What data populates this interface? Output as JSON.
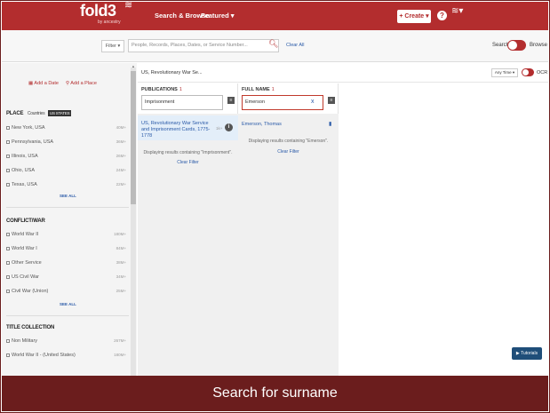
{
  "nav": {
    "logo_text": "fold3",
    "logo_sub": "by ancestry",
    "search_browse": "Search & Browse",
    "featured": "Featured ▾",
    "create": "+ Create ▾",
    "help": "?"
  },
  "search": {
    "filter": "Filter ▾",
    "placeholder": "People, Records, Places, Dates, or Service Number...",
    "clear_all": "Clear All",
    "mode_search": "Search",
    "mode_browse": "Browse"
  },
  "left": {
    "add_date": "Add a Date",
    "add_place": "Add a Place",
    "place": {
      "title": "PLACE",
      "sub": "Countries",
      "tag": "US States",
      "items": [
        {
          "label": "New York, USA",
          "count": "40M+"
        },
        {
          "label": "Pennsylvania, USA",
          "count": "36M+"
        },
        {
          "label": "Illinois, USA",
          "count": "26M+"
        },
        {
          "label": "Ohio, USA",
          "count": "24M+"
        },
        {
          "label": "Texas, USA",
          "count": "22M+"
        }
      ],
      "see_all": "SEE ALL"
    },
    "conflict": {
      "title": "CONFLICT/WAR",
      "items": [
        {
          "label": "World War II",
          "count": "180M+"
        },
        {
          "label": "World War I",
          "count": "84M+"
        },
        {
          "label": "Other Service",
          "count": "38M+"
        },
        {
          "label": "US Civil War",
          "count": "34M+"
        },
        {
          "label": "Civil War (Union)",
          "count": "25M+"
        }
      ],
      "see_all": "SEE ALL"
    },
    "collection": {
      "title": "TITLE COLLECTION",
      "items": [
        {
          "label": "Non Military",
          "count": "267M+"
        },
        {
          "label": "World War II - (United States)",
          "count": "180M+"
        }
      ]
    }
  },
  "crumb": {
    "text": "US, Revolutionary War Se...",
    "any_time": "Any Time ▾",
    "ocr": "OCR"
  },
  "publications": {
    "header": "PUBLICATIONS",
    "count": "1",
    "input": "Imprisonment",
    "result_title": "US, Revolutionary War Service and Imprisonment Cards, 1775-1778",
    "result_count": "1k+",
    "message": "Displaying results containing \"Imprisonment\".",
    "clear_filter": "Clear Filter"
  },
  "full_name": {
    "header": "FULL NAME",
    "count": "1",
    "input": "Emerson",
    "clear_x": "x",
    "result": "Emerson, Thomas",
    "message": "Displaying results containing \"Emerson\".",
    "clear_filter": "Clear Filter"
  },
  "tutorials": "Tutorials",
  "caption": "Search for surname",
  "colors": {
    "brand": "#b32d2e",
    "caption_bg": "#6b1d1d",
    "link": "#2a5aa8"
  }
}
